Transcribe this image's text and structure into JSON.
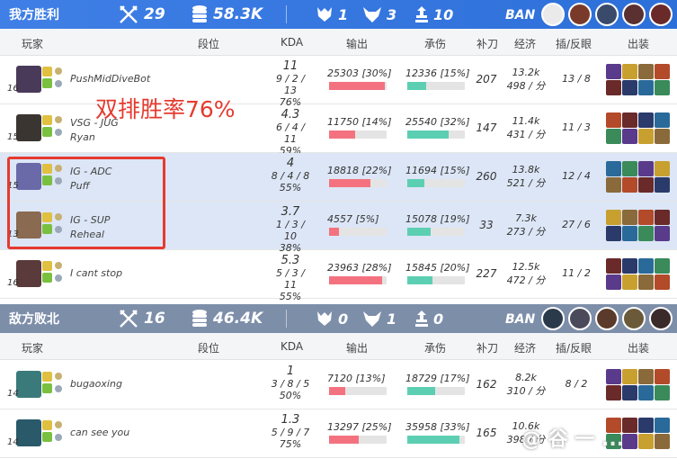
{
  "ally": {
    "title": "我方胜利",
    "kills": "29",
    "gold": "58.3K",
    "obj1": "1",
    "obj2": "3",
    "obj3": "10",
    "ban_label": "BAN"
  },
  "enemy": {
    "title": "敌方败北",
    "kills": "16",
    "gold": "46.4K",
    "obj1": "0",
    "obj2": "1",
    "obj3": "0",
    "ban_label": "BAN"
  },
  "headers": {
    "player": "玩家",
    "rank": "段位",
    "kda": "KDA",
    "damage": "输出",
    "taken": "承伤",
    "cs": "补刀",
    "econ": "经济",
    "ward": "插/反眼",
    "items": "出装"
  },
  "annotation": "双排胜率76%",
  "watermark": "@ 谷 一 ...",
  "ally_players": [
    {
      "name": "PushMidDiveBot",
      "sub": "",
      "level": "16",
      "kills": "11",
      "kda": "9 / 2 / 13",
      "kda_pct": "76%",
      "damage": "25303 [30%]",
      "damage_frac": 0.97,
      "taken": "12336 [15%]",
      "taken_frac": 0.33,
      "cs": "207",
      "gold": "13.2k",
      "gpm": "498 / 分",
      "ward": "13 / 8"
    },
    {
      "name": "VSG - JUG",
      "sub": "Ryan",
      "level": "15",
      "kills": "4.3",
      "kda": "6 / 4 / 11",
      "kda_pct": "59%",
      "damage": "11750 [14%]",
      "damage_frac": 0.45,
      "taken": "25540 [32%]",
      "taken_frac": 0.72,
      "cs": "147",
      "gold": "11.4k",
      "gpm": "431 / 分",
      "ward": "11 / 3"
    },
    {
      "name": "IG - ADC",
      "sub": "Puff",
      "level": "15",
      "kills": "4",
      "kda": "8 / 4 / 8",
      "kda_pct": "55%",
      "damage": "18818 [22%]",
      "damage_frac": 0.72,
      "taken": "11694 [15%]",
      "taken_frac": 0.3,
      "cs": "260",
      "gold": "13.8k",
      "gpm": "521 / 分",
      "ward": "12 / 4"
    },
    {
      "name": "IG - SUP",
      "sub": "Reheal",
      "level": "13",
      "kills": "3.7",
      "kda": "1 / 3 / 10",
      "kda_pct": "38%",
      "damage": "4557 [5%]",
      "damage_frac": 0.17,
      "taken": "15078 [19%]",
      "taken_frac": 0.4,
      "cs": "33",
      "gold": "7.3k",
      "gpm": "273 / 分",
      "ward": "27 / 6"
    },
    {
      "name": "I cant stop",
      "sub": "",
      "level": "16",
      "kills": "5.3",
      "kda": "5 / 3 / 11",
      "kda_pct": "55%",
      "damage": "23963 [28%]",
      "damage_frac": 0.92,
      "taken": "15845 [20%]",
      "taken_frac": 0.43,
      "cs": "227",
      "gold": "12.5k",
      "gpm": "472 / 分",
      "ward": "11 / 2"
    }
  ],
  "enemy_players": [
    {
      "name": "bugaoxing",
      "sub": "",
      "level": "14",
      "kills": "1",
      "kda": "3 / 8 / 5",
      "kda_pct": "50%",
      "damage": "7120 [13%]",
      "damage_frac": 0.28,
      "taken": "18729 [17%]",
      "taken_frac": 0.48,
      "cs": "162",
      "gold": "8.2k",
      "gpm": "310 / 分",
      "ward": "8 / 2"
    },
    {
      "name": "can see you",
      "sub": "",
      "level": "14",
      "kills": "1.3",
      "kda": "5 / 9 / 7",
      "kda_pct": "75%",
      "damage": "13297 [25%]",
      "damage_frac": 0.52,
      "taken": "35958 [33%]",
      "taken_frac": 0.9,
      "cs": "165",
      "gold": "10.6k",
      "gpm": "398 / 分",
      "ward": ""
    }
  ],
  "colors": {
    "damage": "#f4727f",
    "taken": "#5ccfb3",
    "accent": "#3f7fe6",
    "highlight": "#e53a2f"
  }
}
